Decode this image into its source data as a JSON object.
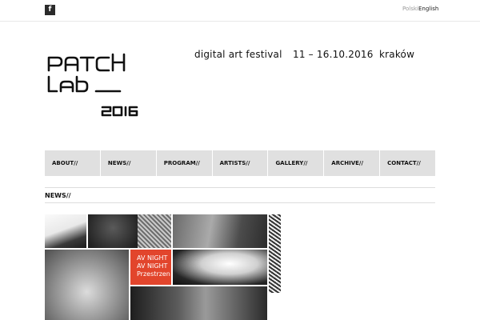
{
  "topbar": {
    "social_icon": "facebook-icon",
    "social_glyph": "f",
    "languages": [
      "Polski",
      "English"
    ],
    "active_language": "English"
  },
  "header": {
    "logo_line1": "PATCH",
    "logo_line2": "Lab",
    "logo_year": "2016",
    "tagline_parts": [
      "digital art festival",
      "11 – 16.10.2016",
      "kraków"
    ]
  },
  "nav": {
    "items": [
      "ABOUT//",
      "NEWS//",
      "PROGRAM//",
      "ARTISTS//",
      "GALLERY//",
      "ARCHIVE//",
      "CONTACT//"
    ]
  },
  "main": {
    "section_title": "NEWS//",
    "tiles": [
      {
        "kind": "photo",
        "label": "news-image-1"
      },
      {
        "kind": "photo",
        "label": "news-image-2"
      },
      {
        "kind": "photo",
        "label": "news-image-3"
      },
      {
        "kind": "photo",
        "label": "news-image-4"
      },
      {
        "kind": "photo",
        "label": "news-image-5"
      },
      {
        "kind": "poster",
        "text_lines": [
          "AV NIGHT",
          "AV NIGHT",
          "Przestrzen"
        ],
        "color": "#e2452c"
      },
      {
        "kind": "photo",
        "label": "news-image-7"
      },
      {
        "kind": "photo",
        "label": "news-image-8"
      }
    ]
  },
  "colors": {
    "nav_bg": "#e0e0e0",
    "accent": "#e2452c",
    "text": "#111111"
  }
}
